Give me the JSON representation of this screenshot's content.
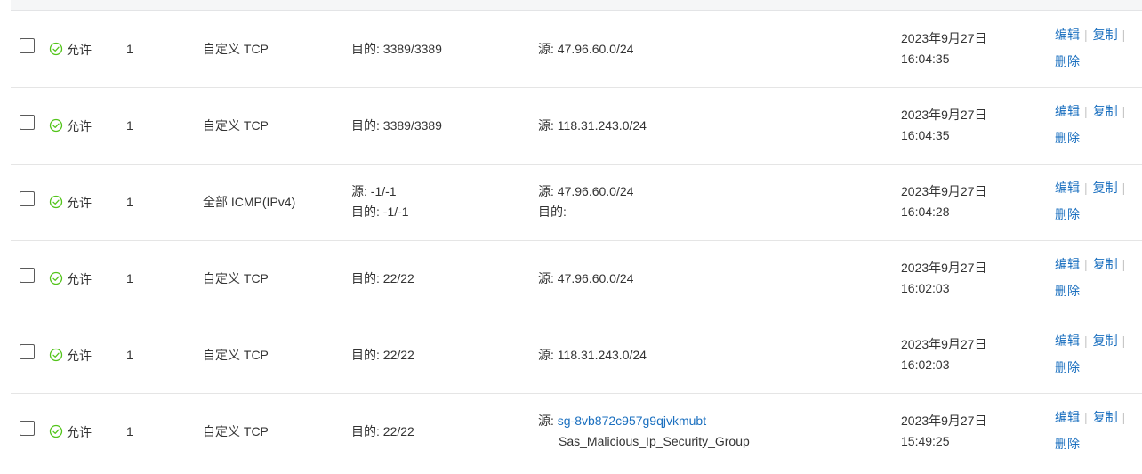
{
  "rows": [
    {
      "status": "允许",
      "priority": "1",
      "protocol": "自定义 TCP",
      "port": [
        "目的: 3389/3389"
      ],
      "auth": {
        "line1_label": "源: ",
        "line1_value": "47.96.60.0/24",
        "line1_link": false,
        "line2": ""
      },
      "date": "2023年9月27日",
      "time": "16:04:35"
    },
    {
      "status": "允许",
      "priority": "1",
      "protocol": "自定义 TCP",
      "port": [
        "目的: 3389/3389"
      ],
      "auth": {
        "line1_label": "源: ",
        "line1_value": "118.31.243.0/24",
        "line1_link": false,
        "line2": ""
      },
      "date": "2023年9月27日",
      "time": "16:04:35"
    },
    {
      "status": "允许",
      "priority": "1",
      "protocol": "全部 ICMP(IPv4)",
      "port": [
        "源: -1/-1",
        "目的: -1/-1"
      ],
      "auth": {
        "line1_label": "源: ",
        "line1_value": "47.96.60.0/24",
        "line1_link": false,
        "line2": "目的:"
      },
      "date": "2023年9月27日",
      "time": "16:04:28"
    },
    {
      "status": "允许",
      "priority": "1",
      "protocol": "自定义 TCP",
      "port": [
        "目的: 22/22"
      ],
      "auth": {
        "line1_label": "源: ",
        "line1_value": "47.96.60.0/24",
        "line1_link": false,
        "line2": ""
      },
      "date": "2023年9月27日",
      "time": "16:02:03"
    },
    {
      "status": "允许",
      "priority": "1",
      "protocol": "自定义 TCP",
      "port": [
        "目的: 22/22"
      ],
      "auth": {
        "line1_label": "源: ",
        "line1_value": "118.31.243.0/24",
        "line1_link": false,
        "line2": ""
      },
      "date": "2023年9月27日",
      "time": "16:02:03"
    },
    {
      "status": "允许",
      "priority": "1",
      "protocol": "自定义 TCP",
      "port": [
        "目的: 22/22"
      ],
      "auth": {
        "line1_label": "源: ",
        "line1_value": "sg-8vb872c957g9qjvkmubt",
        "line1_link": true,
        "line2": "Sas_Malicious_Ip_Security_Group"
      },
      "date": "2023年9月27日",
      "time": "15:49:25"
    }
  ],
  "actions": {
    "edit": "编辑",
    "copy": "复制",
    "delete": "删除",
    "separator": "|"
  },
  "colors": {
    "link": "#1a6fbf",
    "success": "#52c41a",
    "border": "#e5e5e5"
  },
  "icons": {
    "status": "check-circle-icon"
  }
}
